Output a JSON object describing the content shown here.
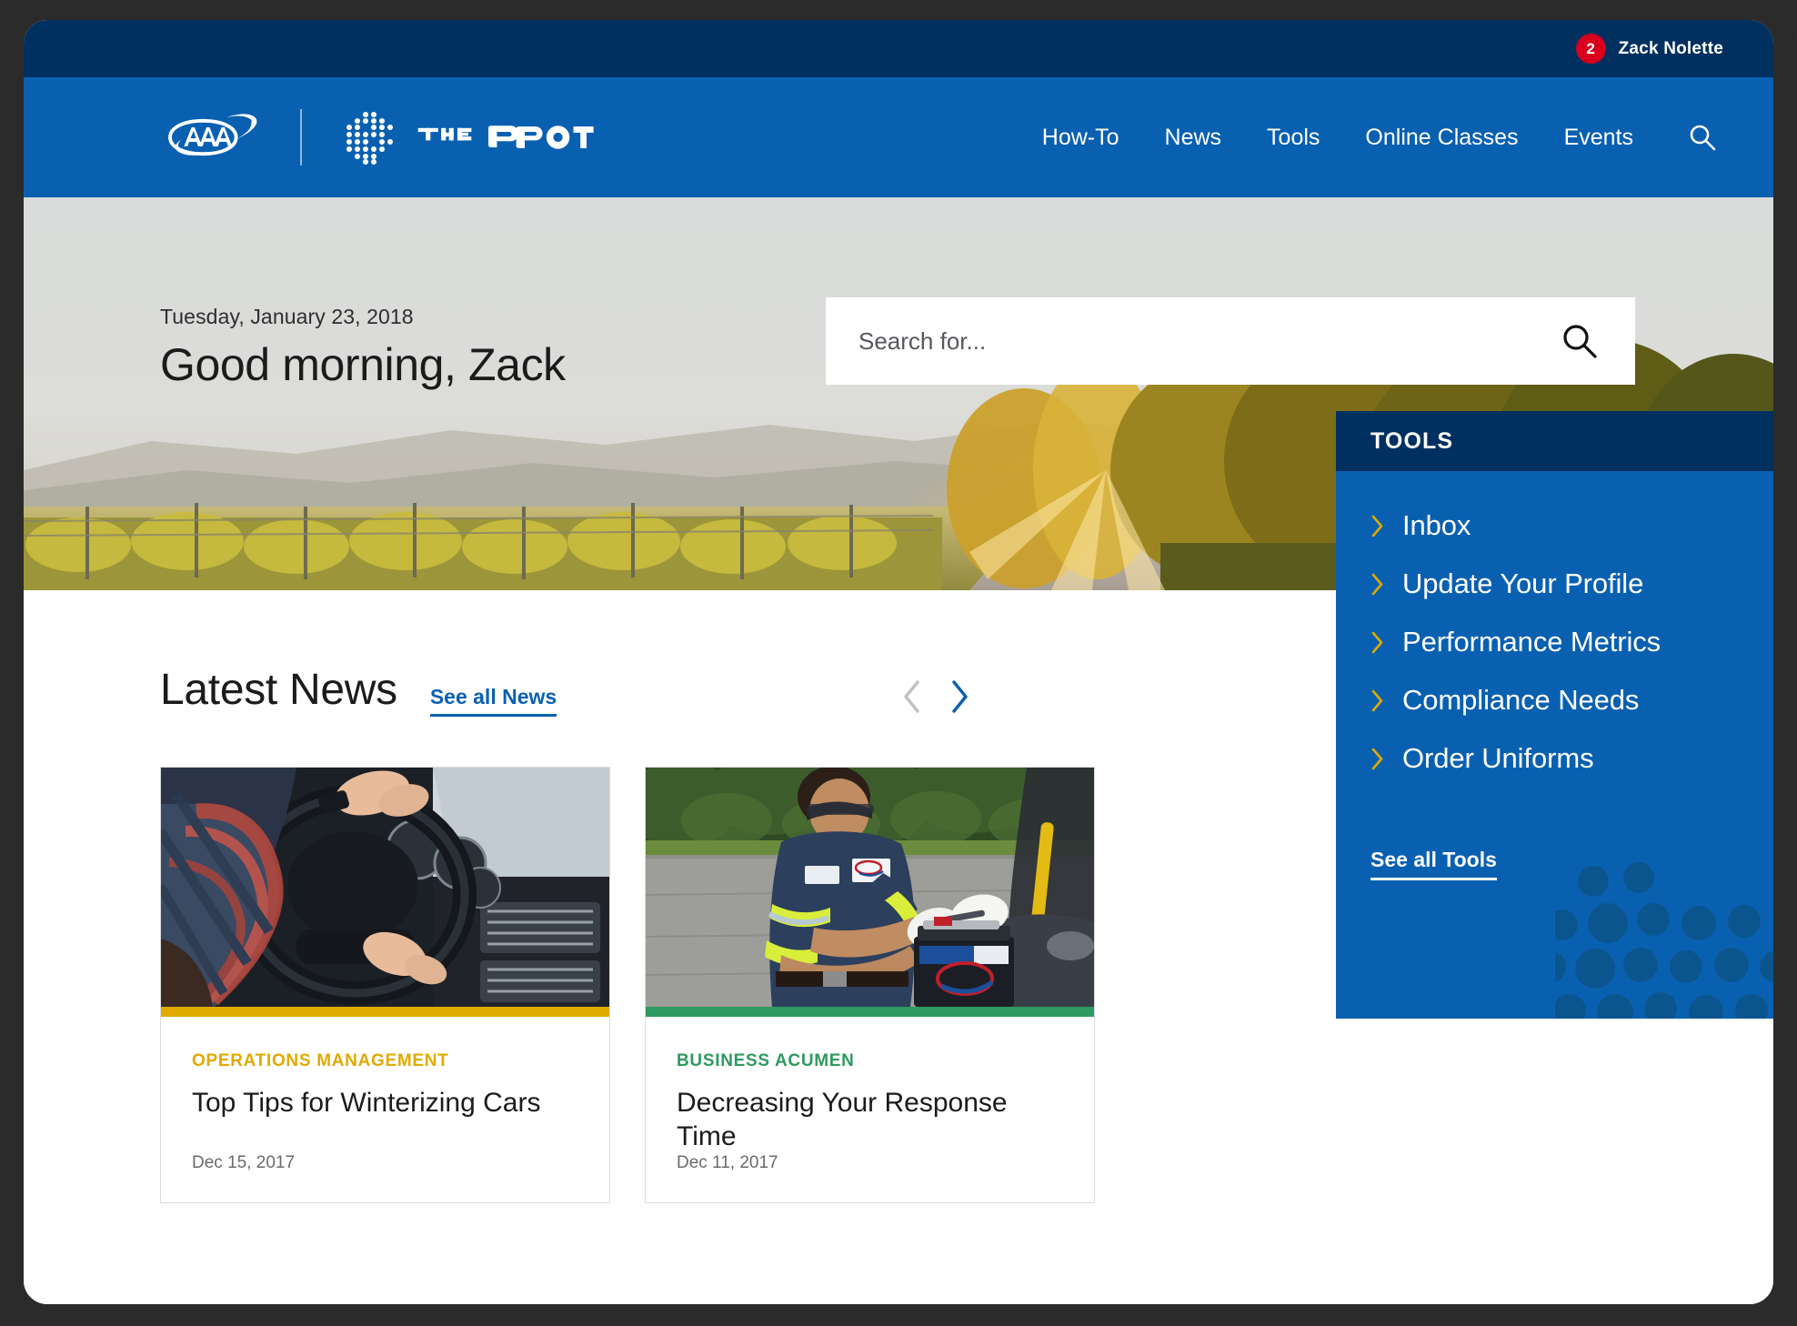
{
  "utility_bar": {
    "notification_count": "2",
    "user_name": "Zack Nolette"
  },
  "header": {
    "brand_aaa": "AAA",
    "brand_spot": "THE SPOT",
    "nav_items": [
      {
        "label": "How-To"
      },
      {
        "label": "News"
      },
      {
        "label": "Tools"
      },
      {
        "label": "Online Classes"
      },
      {
        "label": "Events"
      }
    ],
    "search_icon": "search-icon"
  },
  "hero": {
    "date": "Tuesday, January 23, 2018",
    "greeting": "Good morning, Zack",
    "search_placeholder": "Search for...",
    "search_value": "",
    "search_icon": "search-icon"
  },
  "news": {
    "section_title": "Latest News",
    "see_all_label": "See all News",
    "prev_label": "Previous",
    "next_label": "Next",
    "cards": [
      {
        "category": "OPERATIONS MANAGEMENT",
        "category_color": "#e0aa00",
        "title": "Top Tips for Winterizing Cars",
        "date": "Dec 15, 2017",
        "image_alt": "driver-hands-on-steering-wheel"
      },
      {
        "category": "BUSINESS ACUMEN",
        "category_color": "#2e9960",
        "title": "Decreasing Your Response Time",
        "date": "Dec 11, 2017",
        "image_alt": "aaa-technician-installing-car-battery"
      }
    ]
  },
  "tools": {
    "panel_title": "TOOLS",
    "items": [
      {
        "label": "Inbox"
      },
      {
        "label": "Update Your Profile"
      },
      {
        "label": "Performance Metrics"
      },
      {
        "label": "Compliance Needs"
      },
      {
        "label": "Order Uniforms"
      }
    ],
    "see_all_label": "See all Tools"
  },
  "colors": {
    "utility_navy": "#00305f",
    "header_blue": "#0a60b0",
    "accent_gold": "#e0aa00",
    "accent_green": "#2e9960",
    "badge_red": "#d8001d",
    "link_blue": "#0a60b0"
  }
}
